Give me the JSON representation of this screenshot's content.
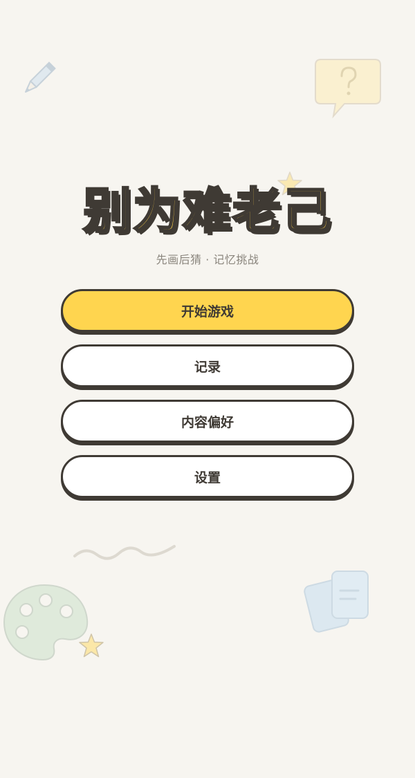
{
  "title": "别为难老己",
  "subtitle": "先画后猜 · 记忆挑战",
  "menu": {
    "start": "开始游戏",
    "records": "记录",
    "preferences": "内容偏好",
    "settings": "设置"
  },
  "icons": [
    "pencil-icon",
    "question-bubble-icon",
    "star-icon",
    "squiggle-icon",
    "palette-icon",
    "cards-icon"
  ],
  "colors": {
    "background": "#f7f5f0",
    "accent": "#ffd54f",
    "outline": "#3f3a34",
    "subtitle": "#8a857d"
  }
}
